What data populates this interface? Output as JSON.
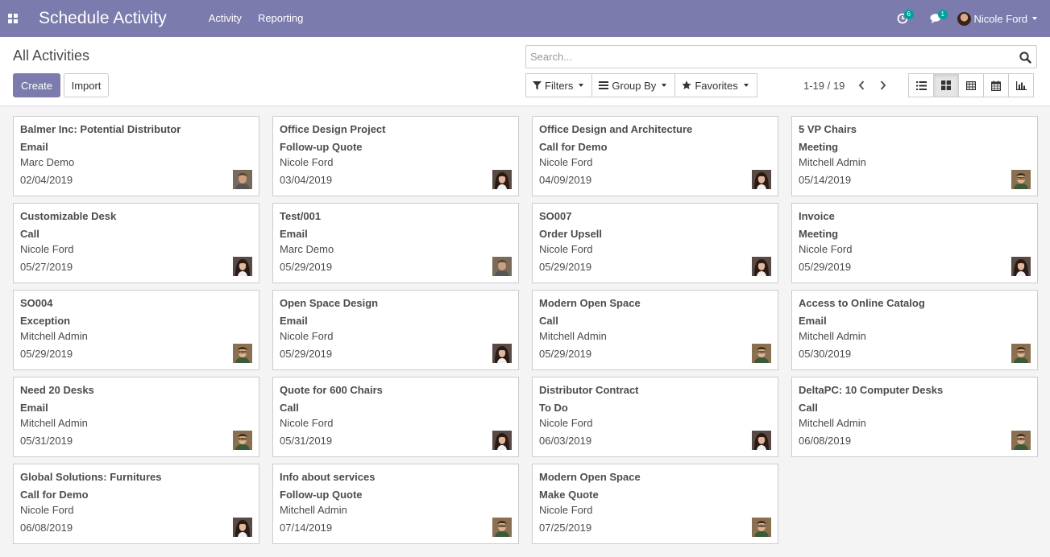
{
  "app": {
    "title": "Schedule Activity",
    "menu": [
      "Activity",
      "Reporting"
    ]
  },
  "systray": {
    "activity_count": "6",
    "messages_count": "1",
    "user_name": "Nicole Ford"
  },
  "control_panel": {
    "breadcrumb": "All Activities",
    "create_label": "Create",
    "import_label": "Import",
    "search_placeholder": "Search...",
    "filters_label": "Filters",
    "groupby_label": "Group By",
    "favorites_label": "Favorites",
    "pager": "1-19 / 19",
    "views": [
      "list",
      "kanban",
      "pivot",
      "calendar",
      "graph"
    ],
    "active_view": "kanban"
  },
  "colors": {
    "brand": "#7c7bad",
    "badge": "#00a09d"
  },
  "activities": [
    {
      "title": "Balmer Inc: Potential Distributor",
      "type": "Email",
      "user": "Marc Demo",
      "date": "02/04/2019",
      "avatar": "marc"
    },
    {
      "title": "Office Design Project",
      "type": "Follow-up Quote",
      "user": "Nicole Ford",
      "date": "03/04/2019",
      "avatar": "nicole"
    },
    {
      "title": "Office Design and Architecture",
      "type": "Call for Demo",
      "user": "Nicole Ford",
      "date": "04/09/2019",
      "avatar": "nicole"
    },
    {
      "title": "5 VP Chairs",
      "type": "Meeting",
      "user": "Mitchell Admin",
      "date": "05/14/2019",
      "avatar": "mitchell"
    },
    {
      "title": "Customizable Desk",
      "type": "Call",
      "user": "Nicole Ford",
      "date": "05/27/2019",
      "avatar": "nicole"
    },
    {
      "title": "Test/001",
      "type": "Email",
      "user": "Marc Demo",
      "date": "05/29/2019",
      "avatar": "marc"
    },
    {
      "title": "SO007",
      "type": "Order Upsell",
      "user": "Nicole Ford",
      "date": "05/29/2019",
      "avatar": "nicole"
    },
    {
      "title": "Invoice",
      "type": "Meeting",
      "user": "Nicole Ford",
      "date": "05/29/2019",
      "avatar": "nicole"
    },
    {
      "title": "SO004",
      "type": "Exception",
      "user": "Mitchell Admin",
      "date": "05/29/2019",
      "avatar": "mitchell"
    },
    {
      "title": "Open Space Design",
      "type": "Email",
      "user": "Nicole Ford",
      "date": "05/29/2019",
      "avatar": "nicole"
    },
    {
      "title": "Modern Open Space",
      "type": "Call",
      "user": "Mitchell Admin",
      "date": "05/29/2019",
      "avatar": "mitchell"
    },
    {
      "title": "Access to Online Catalog",
      "type": "Email",
      "user": "Mitchell Admin",
      "date": "05/30/2019",
      "avatar": "mitchell"
    },
    {
      "title": "Need 20 Desks",
      "type": "Email",
      "user": "Mitchell Admin",
      "date": "05/31/2019",
      "avatar": "mitchell"
    },
    {
      "title": "Quote for 600 Chairs",
      "type": "Call",
      "user": "Nicole Ford",
      "date": "05/31/2019",
      "avatar": "nicole"
    },
    {
      "title": "Distributor Contract",
      "type": "To Do",
      "user": "Nicole Ford",
      "date": "06/03/2019",
      "avatar": "nicole"
    },
    {
      "title": "DeltaPC: 10 Computer Desks",
      "type": "Call",
      "user": "Mitchell Admin",
      "date": "06/08/2019",
      "avatar": "mitchell"
    },
    {
      "title": "Global Solutions: Furnitures",
      "type": "Call for Demo",
      "user": "Nicole Ford",
      "date": "06/08/2019",
      "avatar": "nicole"
    },
    {
      "title": "Info about services",
      "type": "Follow-up Quote",
      "user": "Mitchell Admin",
      "date": "07/14/2019",
      "avatar": "mitchell"
    },
    {
      "title": "Modern Open Space",
      "type": "Make Quote",
      "user": "Nicole Ford",
      "date": "07/25/2019",
      "avatar": "mitchell"
    }
  ]
}
